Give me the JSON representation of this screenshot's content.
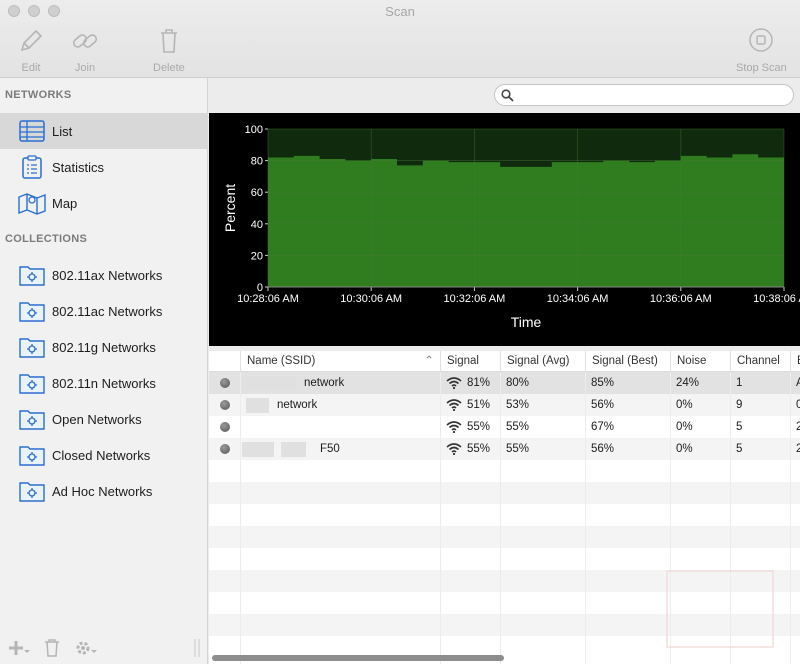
{
  "window": {
    "title": "Scan"
  },
  "toolbar": {
    "edit_label": "Edit",
    "join_label": "Join",
    "delete_label": "Delete",
    "stop_scan_label": "Stop Scan"
  },
  "sidebar": {
    "networks_title": "NETWORKS",
    "network_items": [
      {
        "label": "List",
        "icon": "list-icon"
      },
      {
        "label": "Statistics",
        "icon": "clipboard-icon"
      },
      {
        "label": "Map",
        "icon": "map-icon"
      }
    ],
    "collections_title": "COLLECTIONS",
    "collection_items": [
      {
        "label": "802.11ax Networks",
        "icon": "folder-gear-icon"
      },
      {
        "label": "802.11ac Networks",
        "icon": "folder-gear-icon"
      },
      {
        "label": "802.11g Networks",
        "icon": "folder-gear-icon"
      },
      {
        "label": "802.11n Networks",
        "icon": "folder-gear-icon"
      },
      {
        "label": "Open Networks",
        "icon": "folder-gear-icon"
      },
      {
        "label": "Closed Networks",
        "icon": "folder-gear-icon"
      },
      {
        "label": "Ad Hoc Networks",
        "icon": "folder-gear-icon"
      }
    ]
  },
  "search": {
    "placeholder": "",
    "value": ""
  },
  "chart_data": {
    "type": "area",
    "xlabel": "Time",
    "ylabel": "Percent",
    "ylim": [
      0,
      100
    ],
    "y_ticks": [
      "0",
      "20",
      "40",
      "60",
      "80",
      "100"
    ],
    "x_ticks": [
      "10:28:06 AM",
      "10:30:06 AM",
      "10:32:06 AM",
      "10:34:06 AM",
      "10:36:06 AM",
      "10:38:06 AM"
    ],
    "grid": true,
    "colors": {
      "fill": "#2f7d1f",
      "background": "#0f2a0c",
      "line": "#3a9a29"
    },
    "series": [
      {
        "x": [
          "10:28:06 AM",
          "10:28:36 AM",
          "10:29:06 AM",
          "10:29:36 AM",
          "10:30:06 AM",
          "10:30:36 AM",
          "10:31:06 AM",
          "10:31:36 AM",
          "10:32:06 AM",
          "10:32:36 AM",
          "10:33:06 AM",
          "10:33:36 AM",
          "10:34:06 AM",
          "10:34:36 AM",
          "10:35:06 AM",
          "10:35:36 AM",
          "10:36:06 AM",
          "10:36:36 AM",
          "10:37:06 AM",
          "10:37:36 AM",
          "10:38:06 AM"
        ],
        "values": [
          82,
          83,
          81,
          80,
          81,
          77,
          80,
          79,
          79,
          76,
          76,
          79,
          79,
          80,
          79,
          80,
          83,
          82,
          84,
          82,
          81
        ]
      }
    ]
  },
  "table": {
    "columns": [
      "Name (SSID)",
      "Signal",
      "Signal (Avg)",
      "Signal (Best)",
      "Noise",
      "Channel",
      "B"
    ],
    "rows": [
      {
        "name": "network",
        "signal": "81%",
        "signal_avg": "80%",
        "signal_best": "85%",
        "noise": "24%",
        "channel": "1",
        "extra": "A"
      },
      {
        "name": "network",
        "signal": "51%",
        "signal_avg": "53%",
        "signal_best": "56%",
        "noise": "0%",
        "channel": "9",
        "extra": "0"
      },
      {
        "name": "",
        "signal": "55%",
        "signal_avg": "55%",
        "signal_best": "67%",
        "noise": "0%",
        "channel": "5",
        "extra": "2"
      },
      {
        "name": "F50",
        "signal": "55%",
        "signal_avg": "55%",
        "signal_best": "56%",
        "noise": "0%",
        "channel": "5",
        "extra": "2"
      }
    ]
  }
}
